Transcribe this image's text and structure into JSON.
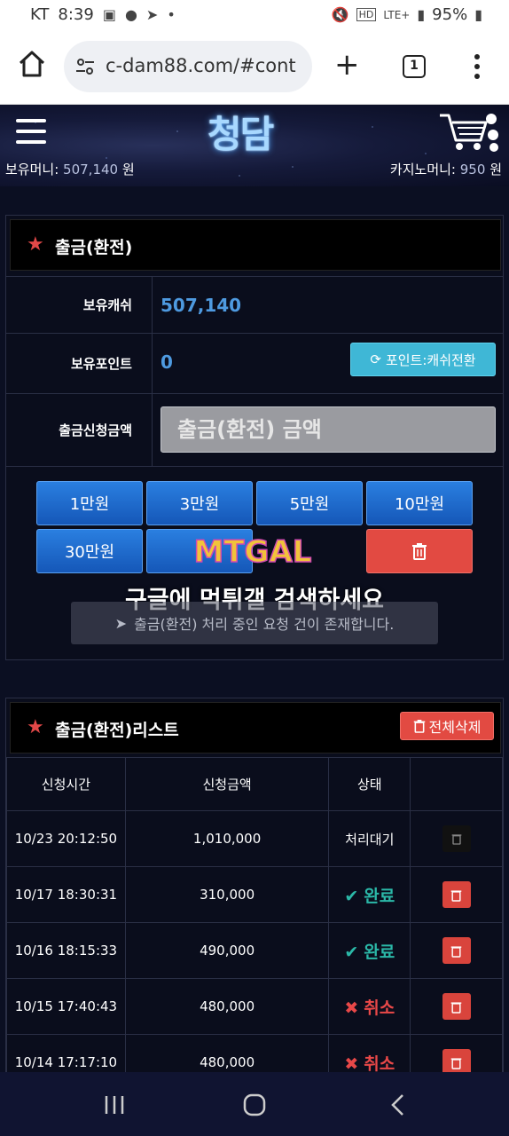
{
  "status_bar": {
    "carrier": "KT",
    "time": "8:39",
    "network": "LTE+",
    "battery": "95%"
  },
  "browser": {
    "url": "c-dam88.com/#cont",
    "tab_count": "1"
  },
  "site": {
    "logo": "청담",
    "money_label": "보유머니:",
    "money_value": "507,140",
    "money_unit": "원",
    "casino_label": "카지노머니:",
    "casino_value": "950",
    "casino_unit": "원"
  },
  "withdraw": {
    "title": "출금(환전)",
    "cash_label": "보유캐쉬",
    "cash_value": "507,140",
    "point_label": "보유포인트",
    "point_value": "0",
    "convert_button": "포인트:캐쉬전환",
    "amount_label": "출금신청금액",
    "amount_placeholder": "출금(환전) 금액",
    "quick_amounts": [
      "1만원",
      "3만원",
      "5만원",
      "10만원",
      "30만원"
    ],
    "notice": "출금(환전) 처리 중인 요청 건이 존재합니다."
  },
  "watermark": {
    "logo_text": "MTGAL",
    "text": "구글에 먹튀갤 검색하세요"
  },
  "list": {
    "title": "출금(환전)리스트",
    "delete_all": "전체삭제",
    "headers": [
      "신청시간",
      "신청금액",
      "상태",
      ""
    ],
    "rows": [
      {
        "time": "10/23 20:12:50",
        "amount": "1,010,000",
        "status": "처리대기"
      },
      {
        "time": "10/17 18:30:31",
        "amount": "310,000",
        "status": "완료"
      },
      {
        "time": "10/16 18:15:33",
        "amount": "490,000",
        "status": "완료"
      },
      {
        "time": "10/15 17:40:43",
        "amount": "480,000",
        "status": "취소"
      },
      {
        "time": "10/14 17:17:10",
        "amount": "480,000",
        "status": "취소"
      }
    ]
  },
  "colors": {
    "accent_blue": "#2a7fe0",
    "danger": "#e24a42",
    "ok": "#2bb8a8",
    "cash_value": "#4e9ae0",
    "convert_button": "#3fb7d6"
  },
  "icons": [
    "home-icon",
    "tune-icon",
    "plus-icon",
    "tabs-icon",
    "more-icon",
    "hamburger-icon",
    "cart-icon",
    "star-icon",
    "refresh-icon",
    "trash-icon",
    "send-icon",
    "check-icon",
    "x-icon",
    "recent-apps-icon",
    "home-nav-icon",
    "back-icon"
  ]
}
